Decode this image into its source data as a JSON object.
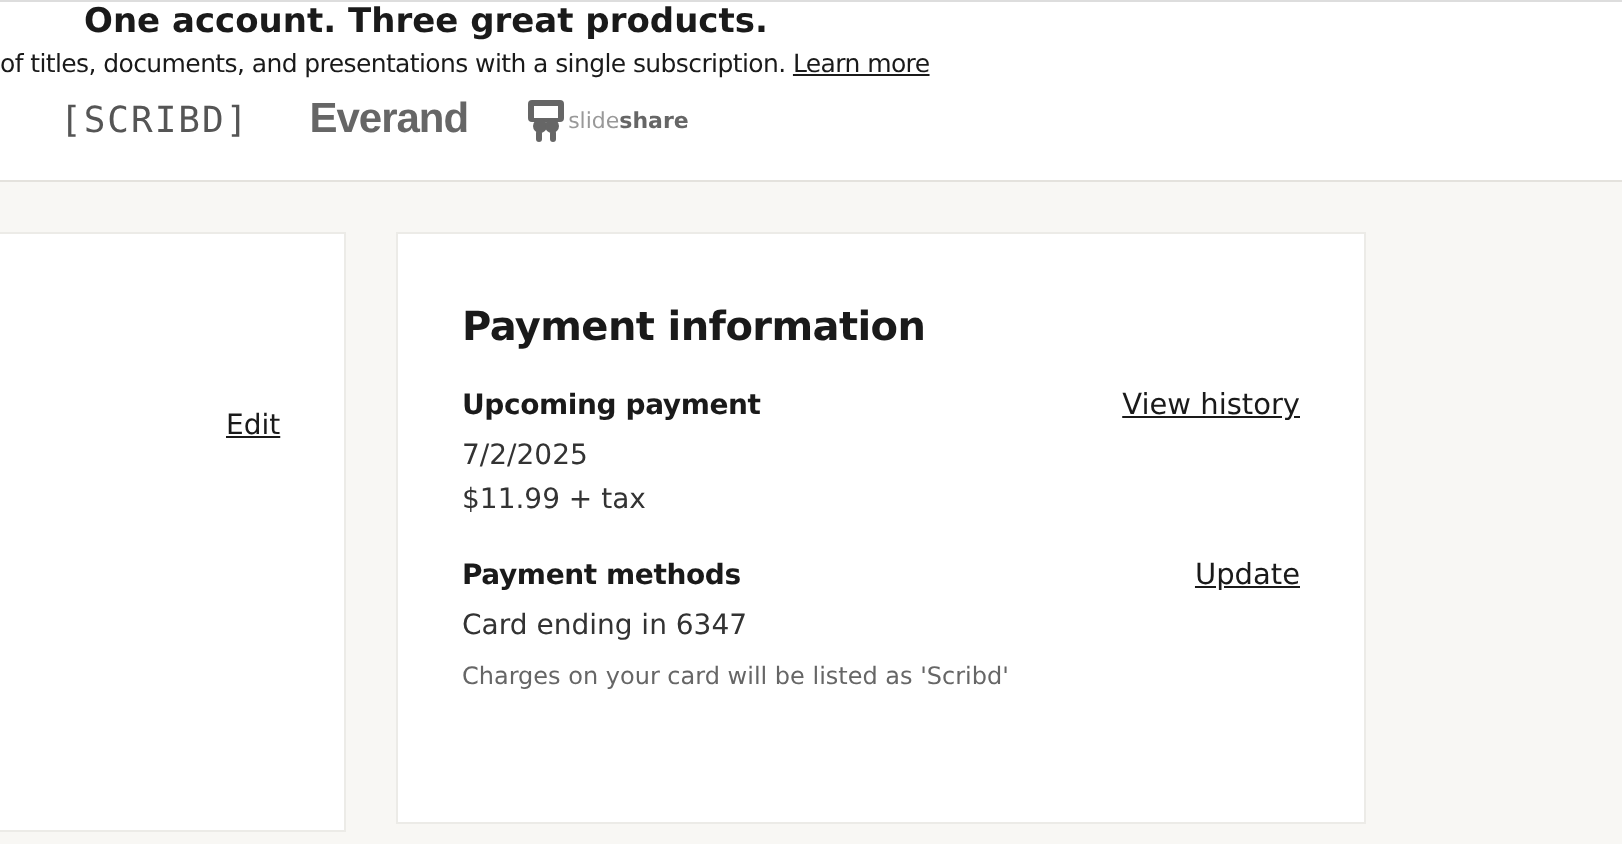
{
  "banner": {
    "heading": "One account. Three great products.",
    "subtitle": "of titles, documents, and presentations with a single subscription.",
    "link": "Learn more",
    "brands": [
      {
        "kind": "scribd",
        "name": "[SCRIBD]"
      },
      {
        "kind": "everand",
        "name": "Everand"
      },
      {
        "kind": "slideshare",
        "name": "slide",
        "name_bold": "share"
      }
    ]
  },
  "account_card": {
    "link": "Edit"
  },
  "payment_card": {
    "title": "Payment information",
    "sections": [
      {
        "heading": "Upcoming payment",
        "link": "View history",
        "lines": [
          "7/2/2025",
          "$11.99 + tax"
        ]
      },
      {
        "heading": "Payment methods",
        "link": "Update",
        "lines": [
          "Card ending in 6347"
        ],
        "note": "Charges on your card will be listed as 'Scribd'"
      }
    ]
  }
}
